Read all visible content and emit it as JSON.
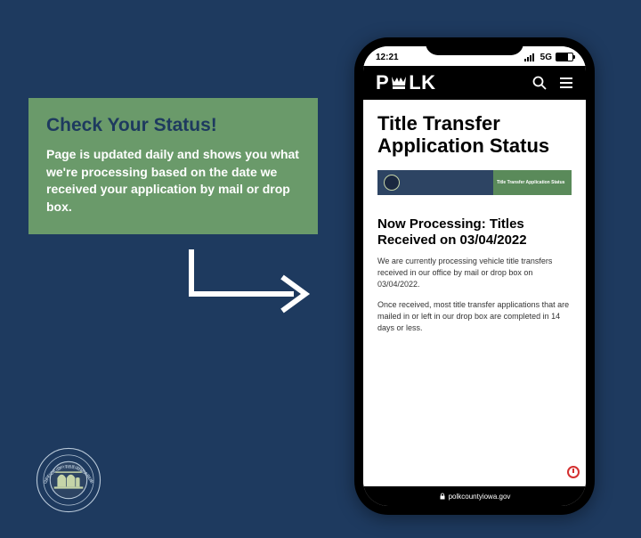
{
  "info_card": {
    "title": "Check Your Status!",
    "body": "Page is updated daily and shows you what we're processing based on the date we received your application by mail or drop box."
  },
  "phone": {
    "status_time": "12:21",
    "status_network": "5G",
    "logo_text_pre": "P",
    "logo_text_post": "LK",
    "page_title": "Title Transfer Application Status",
    "banner_text": "Title Transfer Application Status",
    "section_title": "Now Processing: Titles Received on 03/04/2022",
    "section_body1": "We are currently processing vehicle title transfers received in our office by mail or drop box on 03/04/2022.",
    "section_body2": "Once received, most title transfer applications that are mailed in or left in our drop box are completed in 14 days or less.",
    "url": "polkcountyiowa.gov"
  },
  "colors": {
    "background": "#1e3a5f",
    "card": "#6a9a6a",
    "accent_green": "#5a8a5a"
  }
}
